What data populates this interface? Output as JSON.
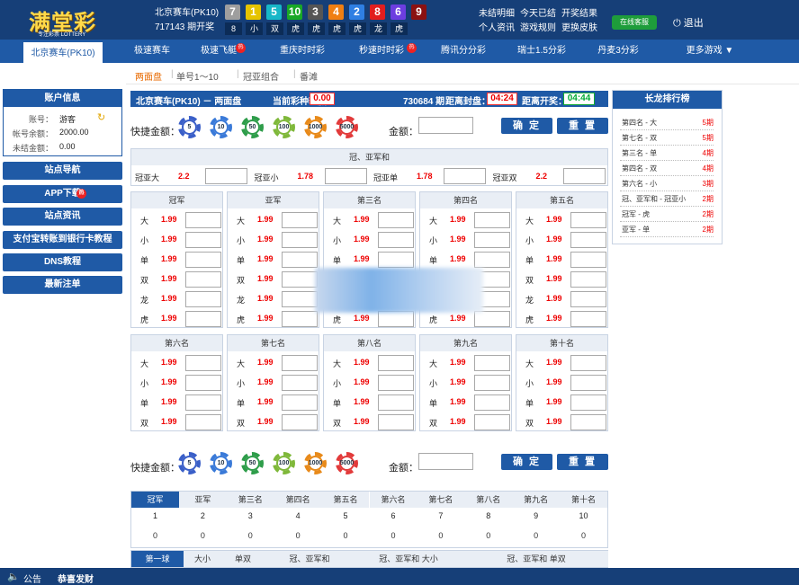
{
  "header": {
    "logo": "满堂彩",
    "logo_sub": "专注彩票 LOTTERY",
    "game": "北京赛车(PK10)",
    "issue": "717143 期开奖",
    "balls": [
      {
        "n": "7",
        "c": "#9e9e9e"
      },
      {
        "n": "1",
        "c": "#e6c400"
      },
      {
        "n": "5",
        "c": "#17b7c8"
      },
      {
        "n": "10",
        "c": "#19a826"
      },
      {
        "n": "3",
        "c": "#555555"
      },
      {
        "n": "4",
        "c": "#f07f12"
      },
      {
        "n": "2",
        "c": "#2f7fe3"
      },
      {
        "n": "8",
        "c": "#e21e1e"
      },
      {
        "n": "6",
        "c": "#6d3ee0"
      },
      {
        "n": "9",
        "c": "#8b1111"
      }
    ],
    "caps": [
      "8",
      "小",
      "双",
      "虎",
      "虎",
      "虎",
      "虎",
      "龙",
      "虎"
    ],
    "links": [
      "未结明细",
      "今天已结",
      "开奖结果",
      "个人资讯",
      "游戏规则",
      "更换皮肤"
    ],
    "online": "在线客服",
    "logout": "退出"
  },
  "nav": [
    "北京赛车(PK10)",
    "极速赛车",
    "极速飞艇",
    "重庆时时彩",
    "秒速时时彩",
    "腾讯分分彩",
    "瑞士1.5分彩",
    "丹麦3分彩",
    "更多游戏 ▼"
  ],
  "subnav": [
    "两面盘",
    "单号1～10",
    "冠亚组合",
    "番滩"
  ],
  "account": {
    "title": "账户信息",
    "rows": [
      {
        "k": "账号：",
        "v": "游客"
      },
      {
        "k": "帐号余额：",
        "v": "2000.00"
      },
      {
        "k": "未结金额：",
        "v": "0.00"
      }
    ]
  },
  "side": [
    "站点导航",
    "APP下载",
    "站点资讯",
    "支付宝转账到银行卡教程",
    "DNS教程",
    "最新注单"
  ],
  "titlebar": {
    "game": "北京赛车(PK10) － 两面盘",
    "profit_label": "当前彩种输赢：",
    "profit": "0.00",
    "issue": "730684 期",
    "close_label": "距离封盘：",
    "close": "04:24",
    "open_label": "距离开奖：",
    "open": "04:44"
  },
  "quick": {
    "label": "快捷金额：",
    "chips": [
      "5",
      "10",
      "50",
      "100",
      "1000",
      "5000"
    ],
    "amount_label": "金额：",
    "confirm": "确 定",
    "reset": "重 置"
  },
  "gy": {
    "title": "冠、亚军和",
    "items": [
      {
        "k": "冠亚大",
        "o": "2.2"
      },
      {
        "k": "冠亚小",
        "o": "1.78"
      },
      {
        "k": "冠亚单",
        "o": "1.78"
      },
      {
        "k": "冠亚双",
        "o": "2.2"
      }
    ]
  },
  "top_groups": [
    {
      "t": "冠军"
    },
    {
      "t": "亚军"
    },
    {
      "t": "第三名"
    },
    {
      "t": "第四名"
    },
    {
      "t": "第五名"
    }
  ],
  "top_rows": [
    "大",
    "小",
    "单",
    "双",
    "龙",
    "虎"
  ],
  "bottom_groups": [
    {
      "t": "第六名"
    },
    {
      "t": "第七名"
    },
    {
      "t": "第八名"
    },
    {
      "t": "第九名"
    },
    {
      "t": "第十名"
    }
  ],
  "bottom_rows": [
    "大",
    "小",
    "单",
    "双"
  ],
  "odd": "1.99",
  "long": {
    "title": "长龙排行榜",
    "rows": [
      {
        "n": "第四名 - 大",
        "p": "5期"
      },
      {
        "n": "第七名 - 双",
        "p": "5期"
      },
      {
        "n": "第三名 - 单",
        "p": "4期"
      },
      {
        "n": "第四名 - 双",
        "p": "4期"
      },
      {
        "n": "第六名 - 小",
        "p": "3期"
      },
      {
        "n": "冠、亚军和 - 冠亚小",
        "p": "2期"
      },
      {
        "n": "冠军 - 虎",
        "p": "2期"
      },
      {
        "n": "亚军 - 单",
        "p": "2期"
      }
    ]
  },
  "stats": {
    "tabs": [
      "冠军",
      "亚军",
      "第三名",
      "第四名",
      "第五名",
      "第六名",
      "第七名",
      "第八名",
      "第九名",
      "第十名"
    ],
    "nums": [
      "1",
      "2",
      "3",
      "4",
      "5",
      "6",
      "7",
      "8",
      "9",
      "10"
    ],
    "counts": [
      "0",
      "0",
      "0",
      "0",
      "0",
      "0",
      "0",
      "0",
      "0",
      "0"
    ]
  },
  "bottom_tabs": [
    "第一球",
    "大小",
    "单双",
    "冠、亚军和",
    "冠、亚军和 大小",
    "冠、亚军和 单双"
  ],
  "footer": {
    "label": "公告",
    "text": "恭喜发财"
  }
}
